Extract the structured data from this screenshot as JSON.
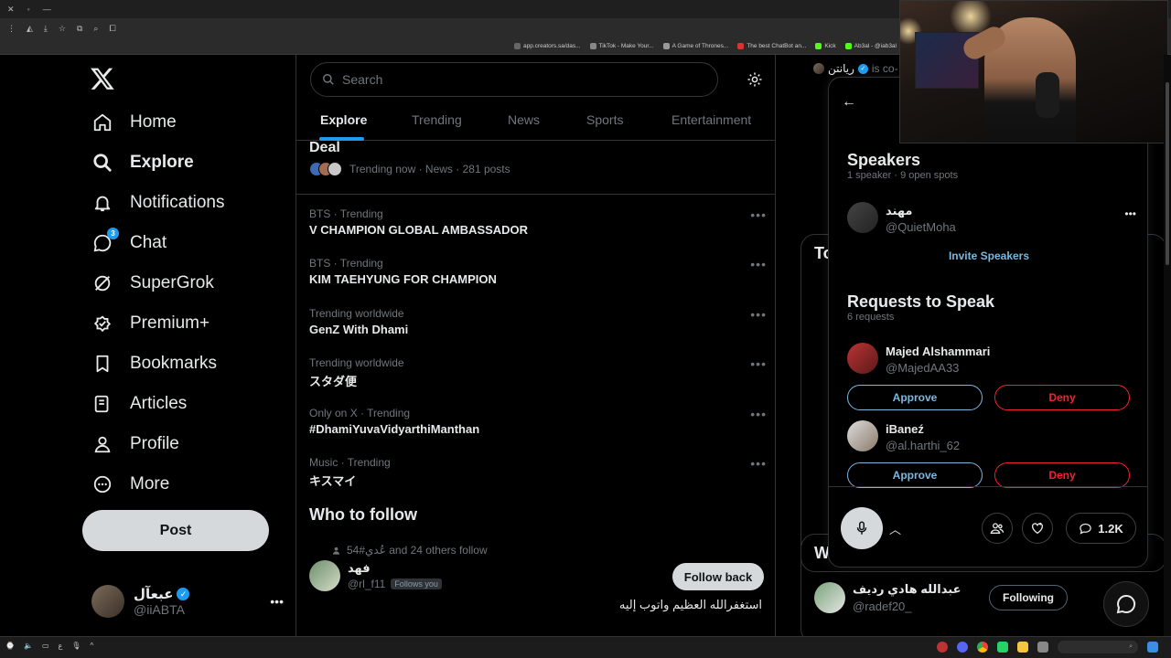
{
  "browser": {
    "bookmarks": [
      "app.creators.sa/das...",
      "TikTok - Make Your...",
      "A Game of Thrones...",
      "The best ChatBot an...",
      "Kick",
      "Ab3al - @iab3al"
    ]
  },
  "nav": {
    "items": [
      {
        "label": "Home",
        "icon": "home-icon"
      },
      {
        "label": "Explore",
        "icon": "search-icon"
      },
      {
        "label": "Notifications",
        "icon": "bell-icon"
      },
      {
        "label": "Chat",
        "icon": "chat-icon",
        "badge": "3"
      },
      {
        "label": "SuperGrok",
        "icon": "grok-icon"
      },
      {
        "label": "Premium+",
        "icon": "premium-icon"
      },
      {
        "label": "Bookmarks",
        "icon": "bookmark-icon"
      },
      {
        "label": "Articles",
        "icon": "article-icon"
      },
      {
        "label": "Profile",
        "icon": "person-icon"
      },
      {
        "label": "More",
        "icon": "more-circle-icon"
      }
    ],
    "post_label": "Post",
    "account": {
      "name": "عبعآل",
      "handle": "@iiABTA"
    }
  },
  "explore": {
    "search_placeholder": "Search",
    "tabs": [
      "Explore",
      "Trending",
      "News",
      "Sports",
      "Entertainment"
    ],
    "deal_title": "Deal",
    "deal_meta": "Trending now · News · 281 posts",
    "trends": [
      {
        "meta": "BTS · Trending",
        "title": "V CHAMPION GLOBAL AMBASSADOR"
      },
      {
        "meta": "BTS · Trending",
        "title": "KIM TAEHYUNG FOR CHAMPION"
      },
      {
        "meta": "Trending worldwide",
        "title": "GenZ With Dhami"
      },
      {
        "meta": "Trending worldwide",
        "title": "スタダ便"
      },
      {
        "meta": "Only on X · Trending",
        "title": "#DhamiYuvaVidyarthiManthan"
      },
      {
        "meta": "Music · Trending",
        "title": "キスマイ"
      }
    ],
    "who_to_follow": "Who to follow",
    "follow_context": "54#عُدي and 24 others follow",
    "follower": {
      "name": "فهد",
      "handle": "@rl_f11",
      "follows_you": "Follows you",
      "button": "Follow back",
      "bio": "استغفرالله العظيم واتوب إليه"
    }
  },
  "right": {
    "top_user": "ريانتن",
    "top_text": "is co-",
    "section_to": "To",
    "section_w": "W",
    "follow_card": {
      "name": "عبدالله هادي رديف",
      "handle": "@radef20_",
      "button": "Following"
    }
  },
  "space": {
    "speakers_title": "Speakers",
    "speakers_sub": "1 speaker · 9 open spots",
    "speaker": {
      "name": "مهند",
      "handle": "@QuietMoha"
    },
    "invite": "Invite Speakers",
    "requests_title": "Requests to Speak",
    "requests_sub": "6 requests",
    "requests": [
      {
        "name": "Majed Alshammari",
        "handle": "@MajedAA33",
        "approve": "Approve",
        "deny": "Deny"
      },
      {
        "name": "iBaneź",
        "handle": "@al.harthi_62",
        "approve": "Approve",
        "deny": "Deny"
      }
    ],
    "listener_count": "1.2K"
  },
  "colors": {
    "accent": "#1d9bf0",
    "deny": "#f4212e",
    "approve": "#7ab8e0"
  }
}
